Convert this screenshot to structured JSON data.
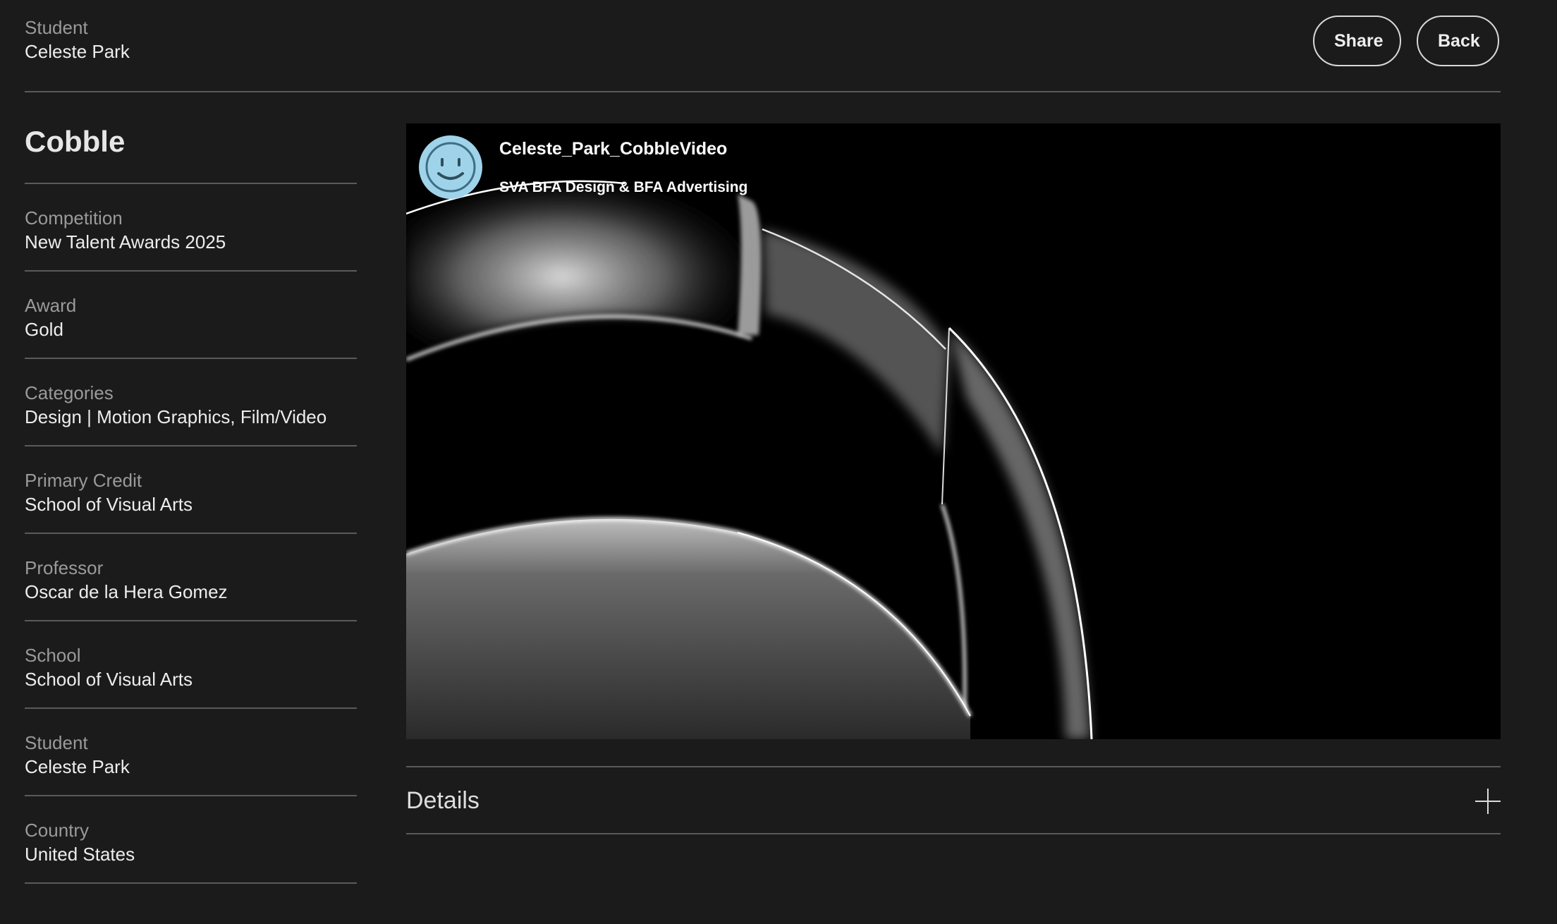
{
  "header": {
    "student_label": "Student",
    "student_name": "Celeste Park",
    "share_label": "Share",
    "back_label": "Back"
  },
  "project": {
    "title": "Cobble",
    "meta": [
      {
        "label": "Competition",
        "value": "New Talent Awards 2025"
      },
      {
        "label": "Award",
        "value": "Gold"
      },
      {
        "label": "Categories",
        "value": "Design | Motion Graphics, Film/Video"
      },
      {
        "label": "Primary Credit",
        "value": "School of Visual Arts"
      },
      {
        "label": "Professor",
        "value": "Oscar de la Hera Gomez"
      },
      {
        "label": "School",
        "value": "School of Visual Arts"
      },
      {
        "label": "Student",
        "value": "Celeste Park"
      },
      {
        "label": "Country",
        "value": "United States"
      }
    ]
  },
  "video": {
    "title": "Celeste_Park_CobbleVideo",
    "channel": "SVA BFA Design & BFA Advertising",
    "avatar_icon": "smiley-face-icon",
    "avatar_color": "#9fd3ea"
  },
  "details": {
    "label": "Details",
    "toggle_icon": "plus-icon"
  }
}
